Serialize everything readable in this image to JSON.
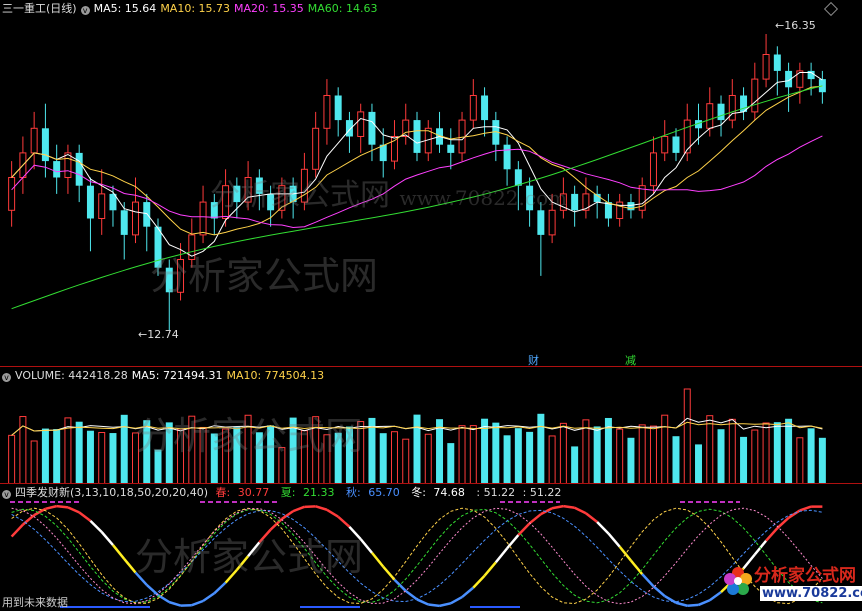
{
  "main": {
    "stock_title": "三一重工(日线)",
    "ma5_label": "MA5: 15.64",
    "ma10_label": "MA10: 15.73",
    "ma20_label": "MA20: 15.35",
    "ma60_label": "MA60: 14.63",
    "high_marker": "16.35",
    "low_marker": "12.74",
    "tag_cai": "财",
    "tag_jian": "减",
    "watermark": "分析家公式网",
    "watermark_url": "www.70822.com"
  },
  "volume": {
    "title": "VOLUME: 442418.28",
    "ma5_label": "MA5: 721494.31",
    "ma10_label": "MA10: 774504.13"
  },
  "indicator": {
    "name": "四季发财新(3,13,10,18,50,20,20,40)",
    "spring_label": "春:",
    "spring_value": "30.77",
    "summer_label": "夏:",
    "summer_value": "21.33",
    "autumn_label": "秋:",
    "autumn_value": "65.70",
    "winter_label": "冬:",
    "winter_value": "74.68",
    "extra1": ": 51.22",
    "extra2": ": 51.22",
    "footer_note": "用到未来数据"
  },
  "brand": {
    "name": "分析家公式网",
    "url": "www.70822.com"
  },
  "colors": {
    "up": "#ff3b3b",
    "down": "#4fe8ee",
    "ma5": "#ffffff",
    "ma10": "#ffd24a",
    "ma20": "#ff40ff",
    "ma60": "#33dd33",
    "spring": "#ff3b3b",
    "summer": "#33dd33",
    "autumn": "#4a90ff",
    "winter": "#ffffff"
  },
  "icons": {
    "title_icon": "circle-toggle-icon",
    "settings": "diamond-icon"
  },
  "chart_data": {
    "type": "candlestick",
    "title": "三一重工(日线)",
    "y_range": [
      12.74,
      16.35
    ],
    "candles": [
      {
        "o": 14.2,
        "c": 14.6,
        "h": 14.8,
        "l": 14.0
      },
      {
        "o": 14.6,
        "c": 14.9,
        "h": 15.1,
        "l": 14.4
      },
      {
        "o": 14.9,
        "c": 15.2,
        "h": 15.4,
        "l": 14.7
      },
      {
        "o": 15.2,
        "c": 14.8,
        "h": 15.5,
        "l": 14.6
      },
      {
        "o": 14.8,
        "c": 14.6,
        "h": 15.0,
        "l": 14.4
      },
      {
        "o": 14.6,
        "c": 14.9,
        "h": 15.0,
        "l": 14.4
      },
      {
        "o": 14.9,
        "c": 14.5,
        "h": 15.0,
        "l": 14.3
      },
      {
        "o": 14.5,
        "c": 14.1,
        "h": 14.6,
        "l": 13.7
      },
      {
        "o": 14.1,
        "c": 14.4,
        "h": 14.7,
        "l": 13.9
      },
      {
        "o": 14.4,
        "c": 14.2,
        "h": 14.5,
        "l": 14.0
      },
      {
        "o": 14.2,
        "c": 13.9,
        "h": 14.3,
        "l": 13.6
      },
      {
        "o": 13.9,
        "c": 14.3,
        "h": 14.6,
        "l": 13.8
      },
      {
        "o": 14.3,
        "c": 14.0,
        "h": 14.4,
        "l": 13.7
      },
      {
        "o": 14.0,
        "c": 13.5,
        "h": 14.1,
        "l": 13.4
      },
      {
        "o": 13.5,
        "c": 13.2,
        "h": 13.6,
        "l": 12.74
      },
      {
        "o": 13.2,
        "c": 13.6,
        "h": 13.8,
        "l": 13.1
      },
      {
        "o": 13.6,
        "c": 13.9,
        "h": 14.1,
        "l": 13.5
      },
      {
        "o": 13.9,
        "c": 14.3,
        "h": 14.5,
        "l": 13.8
      },
      {
        "o": 14.3,
        "c": 14.1,
        "h": 14.4,
        "l": 13.9
      },
      {
        "o": 14.1,
        "c": 14.5,
        "h": 14.7,
        "l": 14.0
      },
      {
        "o": 14.5,
        "c": 14.3,
        "h": 14.6,
        "l": 14.1
      },
      {
        "o": 14.3,
        "c": 14.6,
        "h": 14.8,
        "l": 14.2
      },
      {
        "o": 14.6,
        "c": 14.4,
        "h": 14.7,
        "l": 14.2
      },
      {
        "o": 14.4,
        "c": 14.2,
        "h": 14.5,
        "l": 14.0
      },
      {
        "o": 14.2,
        "c": 14.5,
        "h": 14.6,
        "l": 14.1
      },
      {
        "o": 14.5,
        "c": 14.3,
        "h": 14.6,
        "l": 14.1
      },
      {
        "o": 14.3,
        "c": 14.7,
        "h": 14.9,
        "l": 14.2
      },
      {
        "o": 14.7,
        "c": 15.2,
        "h": 15.4,
        "l": 14.6
      },
      {
        "o": 15.2,
        "c": 15.6,
        "h": 15.8,
        "l": 15.0
      },
      {
        "o": 15.6,
        "c": 15.3,
        "h": 15.7,
        "l": 15.1
      },
      {
        "o": 15.3,
        "c": 15.1,
        "h": 15.4,
        "l": 14.9
      },
      {
        "o": 15.1,
        "c": 15.4,
        "h": 15.5,
        "l": 14.9
      },
      {
        "o": 15.4,
        "c": 15.0,
        "h": 15.5,
        "l": 14.8
      },
      {
        "o": 15.0,
        "c": 14.8,
        "h": 15.2,
        "l": 14.6
      },
      {
        "o": 14.8,
        "c": 15.1,
        "h": 15.3,
        "l": 14.7
      },
      {
        "o": 15.1,
        "c": 15.3,
        "h": 15.5,
        "l": 15.0
      },
      {
        "o": 15.3,
        "c": 14.9,
        "h": 15.4,
        "l": 14.8
      },
      {
        "o": 14.9,
        "c": 15.2,
        "h": 15.3,
        "l": 14.8
      },
      {
        "o": 15.2,
        "c": 15.0,
        "h": 15.4,
        "l": 14.9
      },
      {
        "o": 15.0,
        "c": 14.9,
        "h": 15.2,
        "l": 14.7
      },
      {
        "o": 14.9,
        "c": 15.3,
        "h": 15.4,
        "l": 14.8
      },
      {
        "o": 15.3,
        "c": 15.6,
        "h": 15.8,
        "l": 15.2
      },
      {
        "o": 15.6,
        "c": 15.3,
        "h": 15.7,
        "l": 15.1
      },
      {
        "o": 15.3,
        "c": 15.0,
        "h": 15.4,
        "l": 14.8
      },
      {
        "o": 15.0,
        "c": 14.7,
        "h": 15.1,
        "l": 14.5
      },
      {
        "o": 14.7,
        "c": 14.5,
        "h": 14.8,
        "l": 14.2
      },
      {
        "o": 14.5,
        "c": 14.2,
        "h": 14.6,
        "l": 14.0
      },
      {
        "o": 14.2,
        "c": 13.9,
        "h": 14.3,
        "l": 13.4
      },
      {
        "o": 13.9,
        "c": 14.2,
        "h": 14.4,
        "l": 13.8
      },
      {
        "o": 14.2,
        "c": 14.4,
        "h": 14.6,
        "l": 14.1
      },
      {
        "o": 14.4,
        "c": 14.2,
        "h": 14.5,
        "l": 14.0
      },
      {
        "o": 14.2,
        "c": 14.4,
        "h": 14.6,
        "l": 14.1
      },
      {
        "o": 14.4,
        "c": 14.3,
        "h": 14.5,
        "l": 14.1
      },
      {
        "o": 14.3,
        "c": 14.1,
        "h": 14.4,
        "l": 14.0
      },
      {
        "o": 14.1,
        "c": 14.3,
        "h": 14.4,
        "l": 14.0
      },
      {
        "o": 14.3,
        "c": 14.2,
        "h": 14.4,
        "l": 14.1
      },
      {
        "o": 14.2,
        "c": 14.5,
        "h": 14.6,
        "l": 14.1
      },
      {
        "o": 14.5,
        "c": 14.9,
        "h": 15.1,
        "l": 14.4
      },
      {
        "o": 14.9,
        "c": 15.1,
        "h": 15.3,
        "l": 14.8
      },
      {
        "o": 15.1,
        "c": 14.9,
        "h": 15.2,
        "l": 14.8
      },
      {
        "o": 14.9,
        "c": 15.3,
        "h": 15.5,
        "l": 14.8
      },
      {
        "o": 15.3,
        "c": 15.2,
        "h": 15.5,
        "l": 15.0
      },
      {
        "o": 15.2,
        "c": 15.5,
        "h": 15.7,
        "l": 15.1
      },
      {
        "o": 15.5,
        "c": 15.3,
        "h": 15.6,
        "l": 15.1
      },
      {
        "o": 15.3,
        "c": 15.6,
        "h": 15.8,
        "l": 15.2
      },
      {
        "o": 15.6,
        "c": 15.4,
        "h": 15.7,
        "l": 15.3
      },
      {
        "o": 15.4,
        "c": 15.8,
        "h": 16.0,
        "l": 15.3
      },
      {
        "o": 15.8,
        "c": 16.1,
        "h": 16.35,
        "l": 15.7
      },
      {
        "o": 16.1,
        "c": 15.9,
        "h": 16.2,
        "l": 15.6
      },
      {
        "o": 15.9,
        "c": 15.7,
        "h": 16.0,
        "l": 15.4
      },
      {
        "o": 15.7,
        "c": 15.9,
        "h": 16.0,
        "l": 15.5
      },
      {
        "o": 15.9,
        "c": 15.8,
        "h": 16.0,
        "l": 15.6
      },
      {
        "o": 15.8,
        "c": 15.64,
        "h": 15.9,
        "l": 15.5
      }
    ]
  }
}
